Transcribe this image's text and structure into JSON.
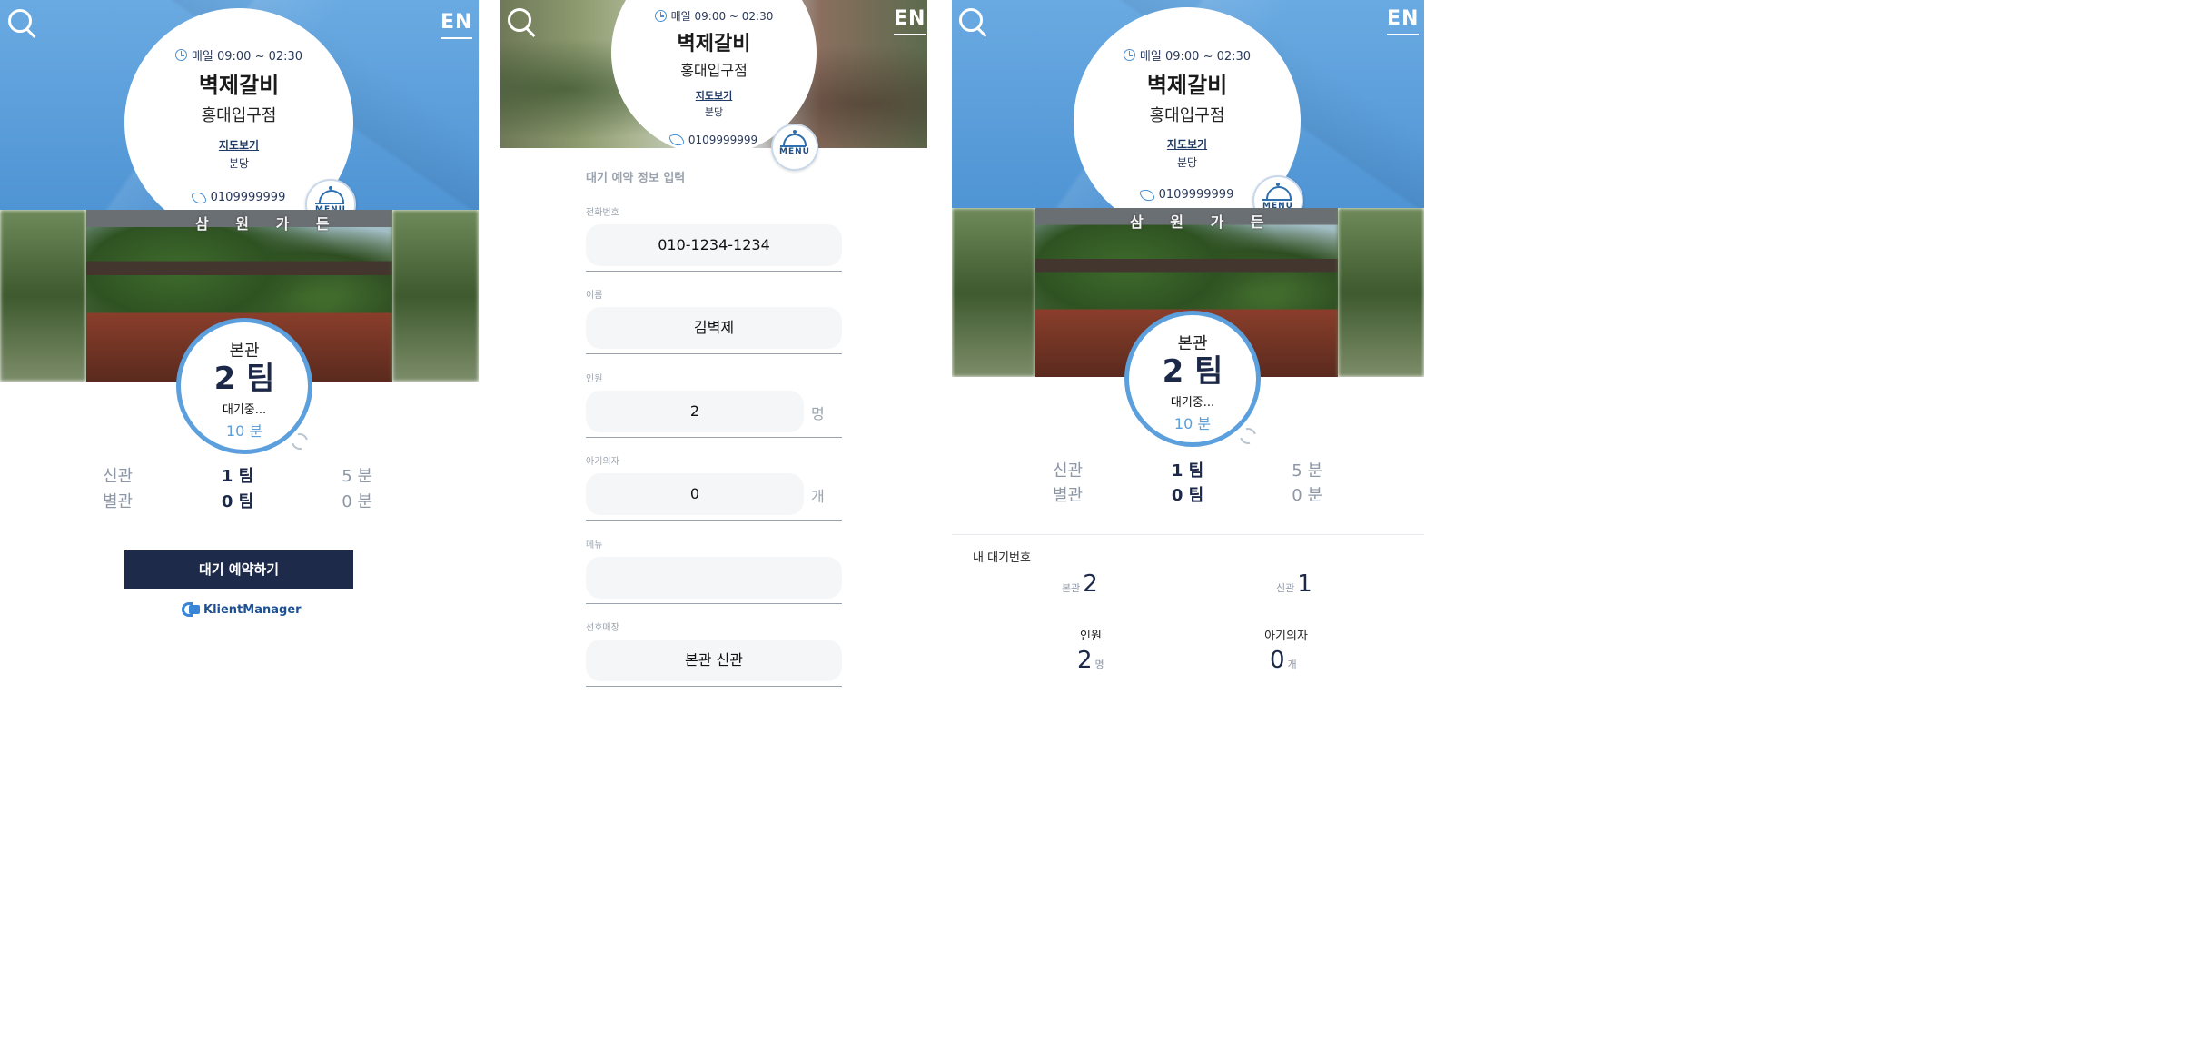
{
  "app": {
    "lang_label": "EN",
    "hours": "매일 09:00 ~ 02:30",
    "store_name": "벽제갈비",
    "branch_name": "홍대입구점",
    "map_link": "지도보기",
    "distance": "분당",
    "phone": "0109999999",
    "menu_label": "MENU",
    "sign_text": "삼 원 가 든"
  },
  "wait": {
    "main_hall": "본관",
    "main_teams": "2 팀",
    "status": "대기중...",
    "main_time": "10 분",
    "halls": [
      {
        "name": "신관",
        "teams": "1 팀",
        "time": "5 분"
      },
      {
        "name": "별관",
        "teams": "0 팀",
        "time": "0 분"
      }
    ]
  },
  "actions": {
    "reserve_button": "대기 예약하기",
    "logo_text": "KlientManager"
  },
  "form": {
    "title": "대기 예약 정보 입력",
    "fields": [
      {
        "label": "전화번호",
        "value": "010-1234-1234",
        "unit": ""
      },
      {
        "label": "이름",
        "value": "김벽제",
        "unit": ""
      },
      {
        "label": "인원",
        "value": "2",
        "unit": "명"
      },
      {
        "label": "아기의자",
        "value": "0",
        "unit": "개"
      },
      {
        "label": "메뉴",
        "value": "",
        "unit": ""
      },
      {
        "label": "선호매장",
        "value": "본관 신관",
        "unit": ""
      }
    ]
  },
  "my_wait": {
    "title": "내 대기번호",
    "main_label": "본관",
    "main_number": "2",
    "new_label": "신관",
    "new_number": "1",
    "people_label": "인원",
    "people_value": "2",
    "people_unit": "명",
    "chair_label": "아기의자",
    "chair_value": "0",
    "chair_unit": "개"
  },
  "colors": {
    "brand_blue": "#5b9fdc",
    "navy": "#1e2a4a",
    "muted": "#8d97a6"
  },
  "icons": [
    "search-icon",
    "clock-icon",
    "phone-icon",
    "menu-cloche-icon",
    "refresh-icon",
    "klientmanager-logo-icon"
  ]
}
